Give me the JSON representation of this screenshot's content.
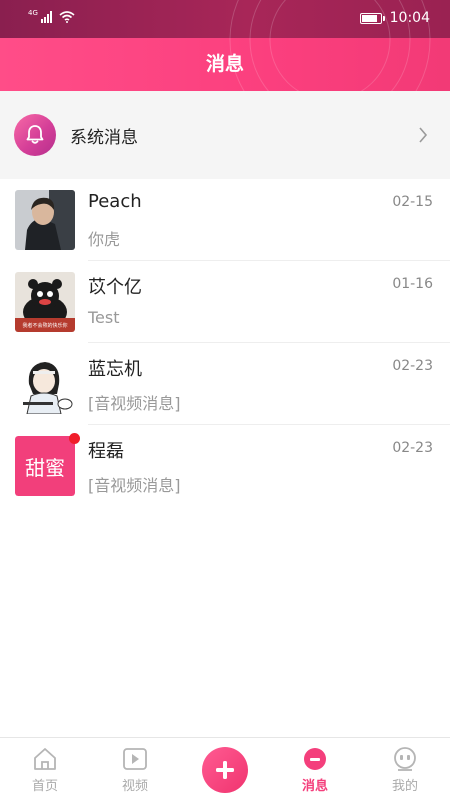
{
  "status_bar": {
    "network": "4G",
    "time": "10:04",
    "battery_level": 0.85
  },
  "header": {
    "title": "消息"
  },
  "system_messages": {
    "label": "系统消息",
    "icon": "bell-icon"
  },
  "conversations": [
    {
      "name": "Peach",
      "date": "02-15",
      "last_message": "你虎",
      "unread": false
    },
    {
      "name": "苡个亿",
      "date": "01-16",
      "last_message": "Test",
      "unread": false,
      "avatar_caption": "我者不会熬的快乐你"
    },
    {
      "name": "蓝忘机",
      "date": "02-23",
      "last_message": "[音视频消息]",
      "unread": false
    },
    {
      "name": "程磊",
      "date": "02-23",
      "last_message": "[音视频消息]",
      "unread": true,
      "avatar_text": "甜蜜"
    }
  ],
  "tabs": [
    {
      "label": "首页",
      "icon": "home-icon"
    },
    {
      "label": "视频",
      "icon": "video-icon"
    },
    {
      "label": "",
      "icon": "plus-icon"
    },
    {
      "label": "消息",
      "icon": "message-icon",
      "active": true
    },
    {
      "label": "我的",
      "icon": "profile-icon"
    }
  ],
  "colors": {
    "accent": "#f43f7c",
    "header": "#fb3f7e",
    "statusbar": "#9a2252",
    "unread_dot": "#f01d2a"
  }
}
